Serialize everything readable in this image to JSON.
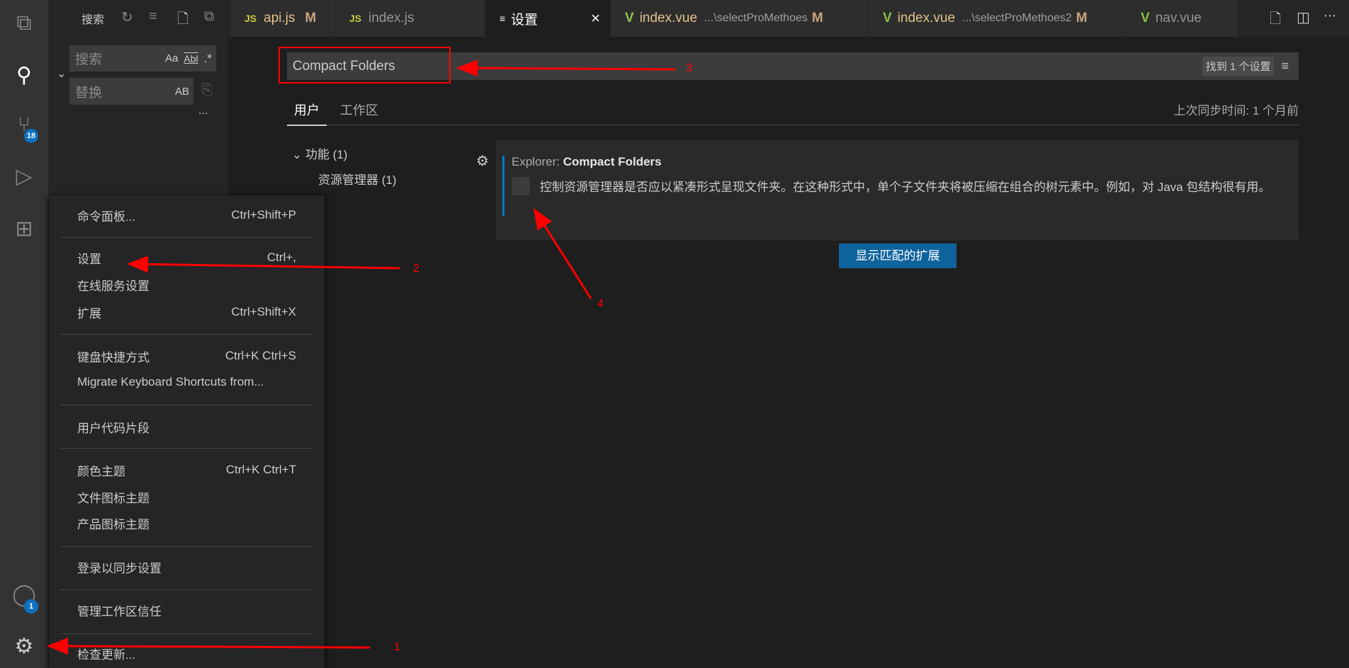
{
  "activity_bar": {
    "items": [
      "explorer-icon",
      "search-icon",
      "source-control-icon",
      "run-debug-icon",
      "extensions-icon"
    ],
    "scm_badge": "18",
    "accounts_badge": "1"
  },
  "sidebar": {
    "title": "搜索",
    "search_placeholder": "搜索",
    "replace_placeholder": "替换",
    "match_case": "Aa",
    "whole_word": "Abl",
    "regex": ".*",
    "preserve_case": "AB",
    "more": "..."
  },
  "tabs": [
    {
      "icon": "JS",
      "label": "api.js",
      "status": "M"
    },
    {
      "icon": "JS",
      "label": "index.js",
      "status": ""
    },
    {
      "icon": "≡",
      "label": "设置",
      "close": "×"
    },
    {
      "icon": "V",
      "label": "index.vue",
      "desc": "...\\selectProMethoes",
      "status": "M"
    },
    {
      "icon": "V",
      "label": "index.vue",
      "desc": "...\\selectProMethoes2",
      "status": "M"
    },
    {
      "icon": "V",
      "label": "nav.vue",
      "status": ""
    }
  ],
  "settings": {
    "search_value": "Compact Folders",
    "result_count": "找到 1 个设置",
    "scope_tabs": [
      "用户",
      "工作区"
    ],
    "active_scope": "用户",
    "last_sync": "上次同步时间: 1 个月前",
    "tree": [
      {
        "label": "功能 (1)"
      },
      {
        "label": "资源管理器 (1)"
      }
    ],
    "setting": {
      "category": "Explorer: ",
      "name": "Compact Folders",
      "checked": false,
      "description": "控制资源管理器是否应以紧凑形式呈现文件夹。在这种形式中，单个子文件夹将被压缩在组合的树元素中。例如，对 Java 包结构很有用。"
    },
    "show_extensions_button": "显示匹配的扩展"
  },
  "menu": [
    {
      "label": "命令面板...",
      "shortcut": "Ctrl+Shift+P"
    },
    {
      "label": "设置",
      "shortcut": "Ctrl+,"
    },
    {
      "label": "在线服务设置",
      "shortcut": ""
    },
    {
      "label": "扩展",
      "shortcut": "Ctrl+Shift+X"
    },
    {
      "label": "键盘快捷方式",
      "shortcut": "Ctrl+K Ctrl+S"
    },
    {
      "label": "Migrate Keyboard Shortcuts from...",
      "shortcut": ""
    },
    {
      "label": "用户代码片段",
      "shortcut": ""
    },
    {
      "label": "颜色主题",
      "shortcut": "Ctrl+K Ctrl+T"
    },
    {
      "label": "文件图标主题",
      "shortcut": ""
    },
    {
      "label": "产品图标主题",
      "shortcut": ""
    },
    {
      "label": "登录以同步设置",
      "shortcut": ""
    },
    {
      "label": "管理工作区信任",
      "shortcut": ""
    },
    {
      "label": "检查更新...",
      "shortcut": ""
    }
  ],
  "annotations": [
    "1",
    "2",
    "3",
    "4"
  ],
  "colors": {
    "accent": "#0e639c",
    "badge": "#0e70c0",
    "annotation": "#ff0000",
    "modified": "#c5a47e"
  }
}
